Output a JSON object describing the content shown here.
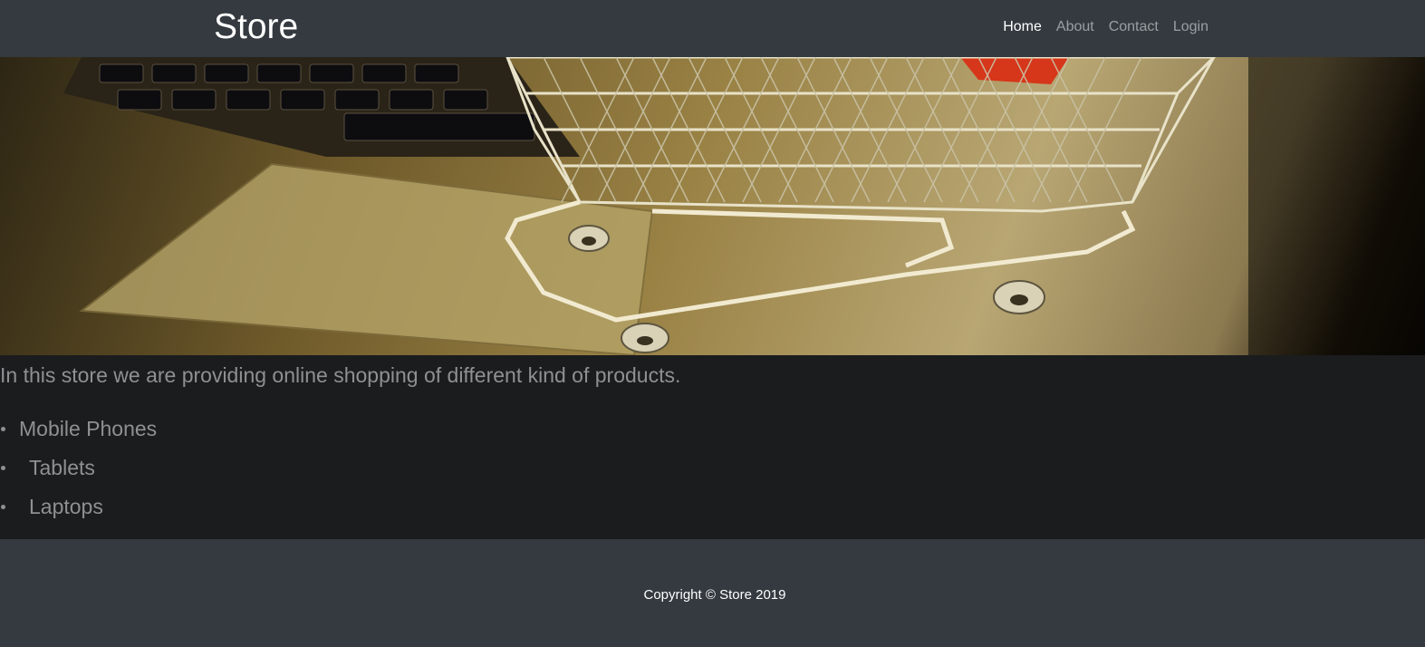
{
  "header": {
    "brand": "Store",
    "nav": [
      {
        "label": "Home",
        "active": true
      },
      {
        "label": "About",
        "active": false
      },
      {
        "label": "Contact",
        "active": false
      },
      {
        "label": "Login",
        "active": false
      }
    ]
  },
  "hero": {
    "image": "shopping-cart-on-laptop-photo"
  },
  "main": {
    "intro": "In this store we are providing online shopping of different kind of products.",
    "categories": [
      "Mobile Phones",
      "Tablets",
      "Laptops"
    ]
  },
  "footer": {
    "copyright": "Copyright © Store 2019"
  },
  "colors": {
    "navbar_bg": "#343a40",
    "page_bg": "#1b1c1e",
    "text_muted": "#8f9091",
    "nav_active": "#ffffff"
  }
}
